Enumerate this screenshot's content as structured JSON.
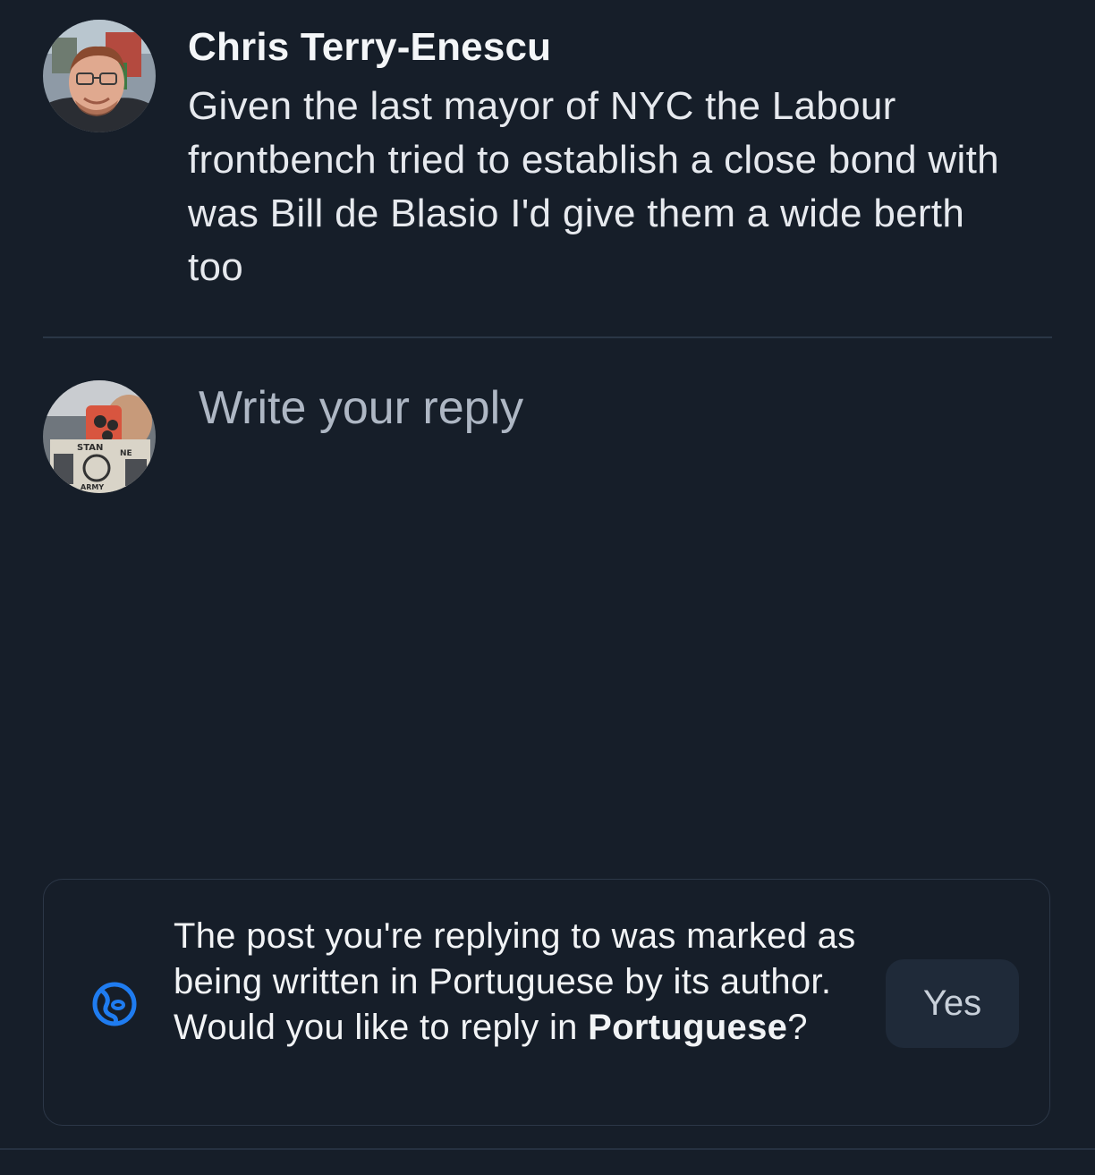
{
  "post": {
    "author": "Chris Terry-Enescu",
    "text": "Given the last mayor of NYC the Labour frontbench tried to establish a close bond with was Bill de Blasio I'd give them a wide berth too",
    "avatar_icon": "author-avatar"
  },
  "reply": {
    "placeholder": "Write your reply",
    "value": "",
    "avatar_icon": "user-avatar",
    "avatar_text": {
      "top": "STAN",
      "bottom": "ARMY",
      "side": "NE"
    }
  },
  "language_prompt": {
    "message_before": "The post you're replying to was marked as being written in Portuguese by its author. Would you like to reply in",
    "language": "Portuguese",
    "message_after": "?",
    "yes_label": "Yes",
    "icon": "language-globe-icon",
    "icon_color": "#1f7cf0"
  },
  "colors": {
    "background": "#161e29",
    "accent": "#1f7cf0",
    "button_bg": "#1f2a39",
    "divider": "#2a3646"
  }
}
